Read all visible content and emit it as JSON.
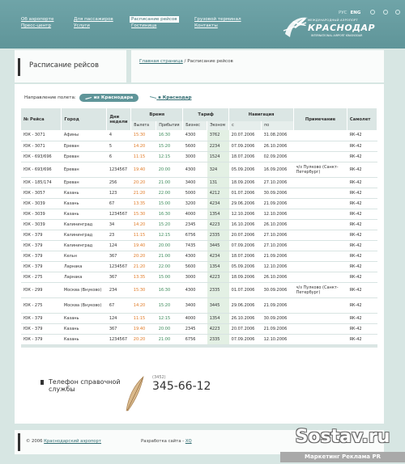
{
  "header": {
    "nav": [
      [
        "Об аэропорте",
        "Пресс-центр"
      ],
      [
        "Для пассажиров",
        "Услуги"
      ],
      [
        "Расписание рейсов",
        "Гостиница"
      ],
      [
        "Грузовой терминал",
        "Контакты"
      ]
    ],
    "active_item": "Расписание рейсов",
    "lang": {
      "ru": "РУС",
      "en": "ENG"
    },
    "logo": {
      "top_line": "МЕЖДУНАРОДНЫЙ АЭРОПОРТ",
      "name": "КРАСНОДАР",
      "bottom_line": "INTERNATIONAL AIRPORT KRASNODAR"
    }
  },
  "page": {
    "title": "Расписание рейсов",
    "breadcrumb_home": "Главная страница",
    "breadcrumb_sep": " / ",
    "breadcrumb_current": "Расписание рейсов"
  },
  "direction": {
    "label": "Направление полета:",
    "from_label": "из Краснодара",
    "to_label": "в Краснодар"
  },
  "table": {
    "headers": {
      "flight": "№ Рейса",
      "city": "Город",
      "days": "Дни недели",
      "time": "Время",
      "departure": "Вылета",
      "arrival": "Прибытия",
      "fare": "Тариф",
      "business": "Бизнес",
      "economy": "Эконом",
      "navigation": "Навигация",
      "from": "с",
      "to": "по",
      "note": "Примечание",
      "aircraft": "Самолет"
    },
    "rows": [
      [
        "ЮК - 3071",
        "Афины",
        "4",
        "15:30",
        "16:30",
        "4300",
        "3762",
        "20.07.2006",
        "31.08.2006",
        "",
        "ЯК-42"
      ],
      [
        "ЮК - 3071",
        "Ереван",
        "5",
        "14:20",
        "15:20",
        "5600",
        "2234",
        "07.09.2006",
        "26.10.2006",
        "",
        "ЯК-42"
      ],
      [
        "ЮК - 693/696",
        "Ереван",
        "6",
        "11:15",
        "12:15",
        "3000",
        "1524",
        "18.07.2006",
        "02.09.2006",
        "",
        "ЯК-42"
      ],
      [
        "ЮК - 693/696",
        "Ереван",
        "1234567",
        "19:40",
        "20:00",
        "4300",
        "324",
        "05.09.2006",
        "16.09.2006",
        "ч/з Пулково (Санкт-Петербург)",
        "ЯК-42"
      ],
      [
        "ЮК - 185/174",
        "Ереван",
        "256",
        "20:20",
        "21:00",
        "3400",
        "131",
        "18.09.2006",
        "27.10.2006",
        "",
        "ЯК-42"
      ],
      [
        "ЮК - 3057",
        "Казань",
        "123",
        "21:20",
        "22:00",
        "5000",
        "4212",
        "01.07.2006",
        "30.09.2006",
        "",
        "ЯК-42"
      ],
      [
        "ЮК - 3039",
        "Казань",
        "67",
        "13:35",
        "15:00",
        "3200",
        "4234",
        "29.06.2006",
        "21.09.2006",
        "",
        "ЯК-42"
      ],
      [
        "ЮК - 3039",
        "Казань",
        "1234567",
        "15:30",
        "16:30",
        "4000",
        "1354",
        "12.10.2006",
        "12.10.2006",
        "",
        "ЯК-42"
      ],
      [
        "ЮК - 3039",
        "Калининград",
        "34",
        "14:20",
        "15:20",
        "2345",
        "4223",
        "16.10.2006",
        "26.10.2006",
        "",
        "ЯК-42"
      ],
      [
        "ЮК - 379",
        "Калининград",
        "23",
        "11:15",
        "12:15",
        "6756",
        "2335",
        "20.07.2006",
        "27.10.2006",
        "",
        "ЯК-42"
      ],
      [
        "ЮК - 379",
        "Калининград",
        "124",
        "19:40",
        "20:00",
        "7435",
        "3445",
        "07.09.2006",
        "27.10.2006",
        "",
        "ЯК-42"
      ],
      [
        "ЮК - 379",
        "Кельн",
        "367",
        "20:20",
        "21:00",
        "4300",
        "4234",
        "18.07.2006",
        "21.09.2006",
        "",
        "ЯК-42"
      ],
      [
        "ЮК - 379",
        "Ларнака",
        "1234567",
        "21:20",
        "22:00",
        "5600",
        "1354",
        "05.09.2006",
        "12.10.2006",
        "",
        "ЯК-42"
      ],
      [
        "ЮК - 275",
        "Ларнака",
        "367",
        "13:35",
        "15:00",
        "3000",
        "4223",
        "18.09.2006",
        "26.10.2006",
        "",
        "ЯК-42"
      ],
      [
        "ЮК - 299",
        "Москва (Внуково)",
        "234",
        "15:30",
        "16:30",
        "4300",
        "2335",
        "01.07.2006",
        "30.09.2006",
        "ч/з Пулково (Санкт-Петербург)",
        "ЯК-42"
      ],
      [
        "ЮК - 275",
        "Москва (Внуково)",
        "67",
        "14:20",
        "15:20",
        "3400",
        "3445",
        "29.06.2006",
        "21.09.2006",
        "",
        "ЯК-42"
      ],
      [
        "ЮК - 379",
        "Казань",
        "124",
        "11:15",
        "12:15",
        "4000",
        "1354",
        "26.10.2006",
        "30.09.2006",
        "",
        "ЯК-42"
      ],
      [
        "ЮК - 379",
        "Казань",
        "367",
        "19:40",
        "20:00",
        "2345",
        "4223",
        "20.07.2006",
        "21.09.2006",
        "",
        "ЯК-42"
      ],
      [
        "ЮК - 379",
        "Казань",
        "1234567",
        "20:20",
        "21:00",
        "6756",
        "2335",
        "07.09.2006",
        "12.10.2006",
        "",
        "ЯК-42"
      ]
    ]
  },
  "phone": {
    "label_line1": "Телефон справочной",
    "label_line2": "службы",
    "code": "(3452)",
    "number": "345-66-12"
  },
  "footer": {
    "copy": "© 2006",
    "copy_link": "Краснодарский аэропорт",
    "dev_label": "Разработка сайта -",
    "dev_link": "XQ"
  },
  "watermark": {
    "big": "Sostav.ru",
    "small": "Маркетинг Реклама PR"
  },
  "colors": {
    "header": "#5f9599",
    "departure_time": "#e07b27",
    "arrival_time": "#3c8a5a",
    "economy_bg": "#e3f0e4",
    "table_header": "#dbe6e4"
  }
}
